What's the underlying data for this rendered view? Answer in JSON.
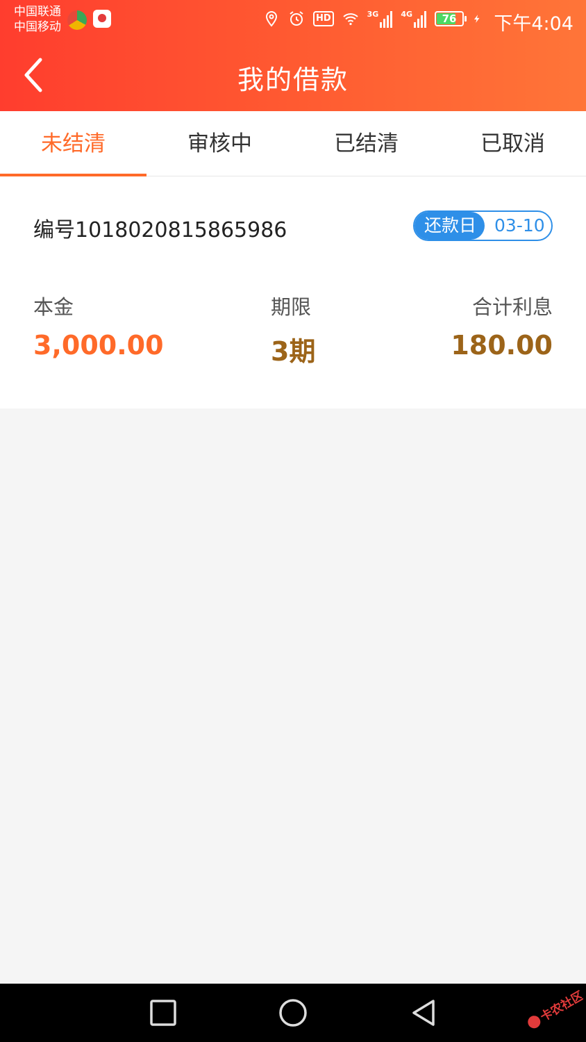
{
  "status_bar": {
    "carrier_1": "中国联通",
    "carrier_2": "中国移动",
    "hd_badge": "HD",
    "net_1": "3G",
    "net_2": "4G",
    "battery_level": "76",
    "battery_fraction": 0.76,
    "time": "下午4:04",
    "icons": [
      "location-icon",
      "alarm-icon",
      "hd-icon",
      "wifi-icon",
      "signal-3g-icon",
      "signal-4g-icon",
      "battery-icon",
      "charging-icon"
    ]
  },
  "header": {
    "title": "我的借款",
    "back_icon": "chevron-left-icon"
  },
  "tabs": [
    {
      "label": "未结清",
      "active": true
    },
    {
      "label": "审核中",
      "active": false
    },
    {
      "label": "已结清",
      "active": false
    },
    {
      "label": "已取消",
      "active": false
    }
  ],
  "loan": {
    "number": "编号1018020815865986",
    "repay_label": "还款日",
    "repay_date": "03-10",
    "principal_label": "本金",
    "principal_value": "3,000.00",
    "term_label": "期限",
    "term_value": "3期",
    "interest_label": "合计利息",
    "interest_value": "180.00"
  },
  "colors": {
    "accent": "#ff6a29",
    "header_start": "#ff3d2e",
    "header_end": "#ff7538",
    "pill_blue": "#2e8fe8",
    "value_brown": "#9c6419"
  },
  "nav_icons": [
    "square-recents-icon",
    "circle-home-icon",
    "triangle-back-icon"
  ],
  "watermark": "卡农社区"
}
